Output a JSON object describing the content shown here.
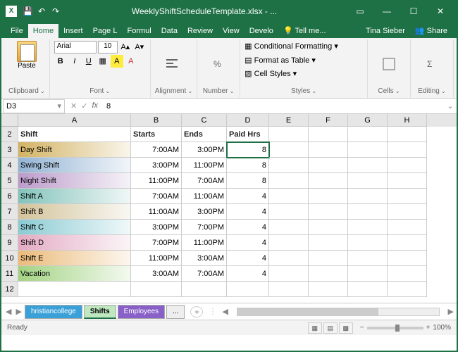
{
  "window": {
    "title": "WeeklyShiftScheduleTemplate.xlsx - ...",
    "app_letter": "X"
  },
  "tabs": {
    "file": "File",
    "home": "Home",
    "insert": "Insert",
    "pagelayout": "Page L",
    "formulas": "Formul",
    "data": "Data",
    "review": "Review",
    "view": "View",
    "developer": "Develo",
    "tellme": "Tell me...",
    "user": "Tina Sieber",
    "share": "Share"
  },
  "ribbon": {
    "clipboard": {
      "label": "Clipboard",
      "paste": "Paste"
    },
    "font": {
      "label": "Font",
      "name": "Arial",
      "size": "10"
    },
    "alignment": {
      "label": "Alignment"
    },
    "number": {
      "label": "Number"
    },
    "styles": {
      "label": "Styles",
      "conditional": "Conditional Formatting",
      "table": "Format as Table",
      "cellstyles": "Cell Styles"
    },
    "cells": {
      "label": "Cells"
    },
    "editing": {
      "label": "Editing"
    }
  },
  "namebox": "D3",
  "formula": "8",
  "columns": [
    "A",
    "B",
    "C",
    "D",
    "E",
    "F",
    "G",
    "H"
  ],
  "headers": {
    "shift": "Shift",
    "starts": "Starts",
    "ends": "Ends",
    "paidhrs": "Paid Hrs"
  },
  "rows": [
    {
      "n": 3,
      "grad": "g-gold",
      "shift": "Day Shift",
      "starts": "7:00AM",
      "ends": "3:00PM",
      "paid": "8"
    },
    {
      "n": 4,
      "grad": "g-blue",
      "shift": "Swing Shift",
      "starts": "3:00PM",
      "ends": "11:00PM",
      "paid": "8"
    },
    {
      "n": 5,
      "grad": "g-purple",
      "shift": "Night Shift",
      "starts": "11:00PM",
      "ends": "7:00AM",
      "paid": "8"
    },
    {
      "n": 6,
      "grad": "g-teal",
      "shift": "Shift A",
      "starts": "7:00AM",
      "ends": "11:00AM",
      "paid": "4"
    },
    {
      "n": 7,
      "grad": "g-tan",
      "shift": "Shift B",
      "starts": "11:00AM",
      "ends": "3:00PM",
      "paid": "4"
    },
    {
      "n": 8,
      "grad": "g-cyan",
      "shift": "Shift C",
      "starts": "3:00PM",
      "ends": "7:00PM",
      "paid": "4"
    },
    {
      "n": 9,
      "grad": "g-pink",
      "shift": "Shift  D",
      "starts": "7:00PM",
      "ends": "11:00PM",
      "paid": "4"
    },
    {
      "n": 10,
      "grad": "g-orange",
      "shift": "Shift E",
      "starts": "11:00PM",
      "ends": "3:00AM",
      "paid": "4"
    },
    {
      "n": 11,
      "grad": "g-green",
      "shift": "Vacation",
      "starts": "3:00AM",
      "ends": "7:00AM",
      "paid": "4"
    }
  ],
  "sheets": {
    "t1": "hristiancollege",
    "t2": "Shifts",
    "t3": "Employees",
    "more": "..."
  },
  "status": {
    "ready": "Ready",
    "zoom": "100%"
  }
}
